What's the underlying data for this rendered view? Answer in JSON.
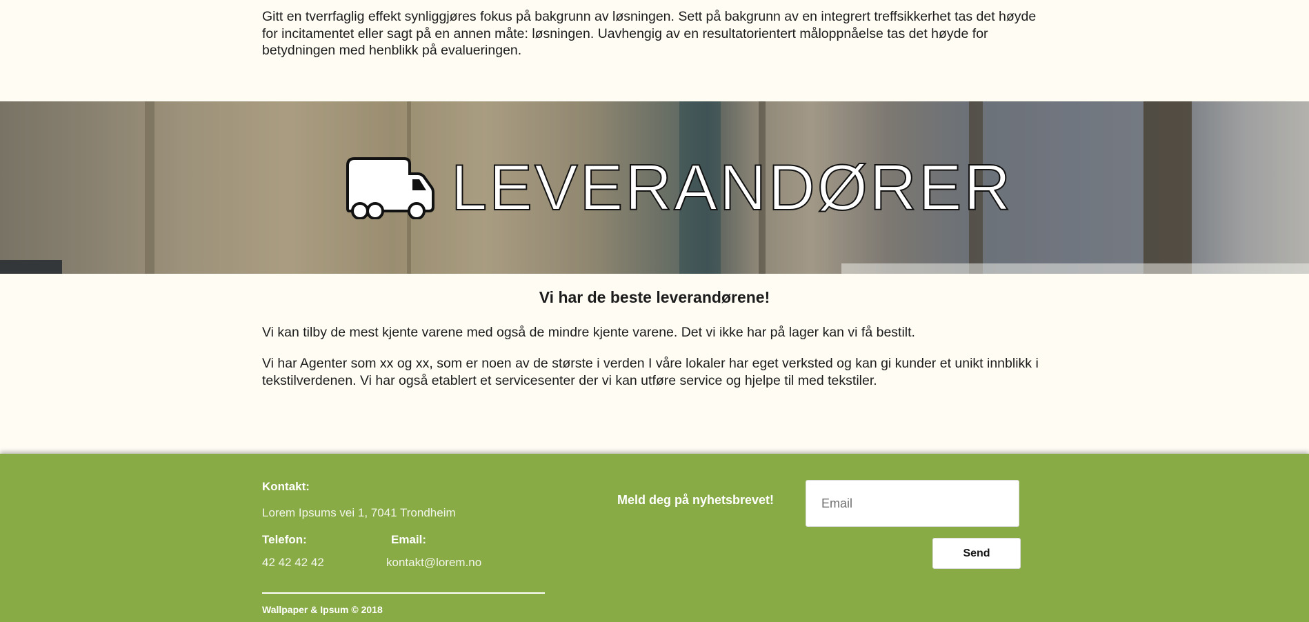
{
  "intro": {
    "text": "Gitt en tverrfaglig effekt synliggjøres fokus på bakgrunn av løsningen. Sett på bakgrunn av en integrert treffsikkerhet tas det høyde for incitamentet eller sagt på en annen måte: løsningen. Uavhengig av en resultatorientert måloppnåelse tas det høyde for betydningen med henblikk på evalueringen."
  },
  "banner": {
    "icon": "truck-icon",
    "title": "LEVERANDØRER"
  },
  "section": {
    "heading": "Vi har de beste leverandørene!",
    "paragraphs": [
      "Vi kan tilby de mest kjente varene med også de mindre kjente varene. Det vi ikke har på lager kan vi få bestilt.",
      "Vi har Agenter som xx og xx, som er noen av de største i verden I våre lokaler har eget verksted og kan gi kunder et unikt innblikk i tekstilverdenen. Vi har også etablert et servicesenter der vi kan utføre service og hjelpe til med tekstiler."
    ]
  },
  "footer": {
    "contact_label": "Kontakt:",
    "address": "Lorem Ipsums vei 1, 7041 Trondheim",
    "phone_label": "Telefon:",
    "phone": "42 42 42 42",
    "email_label": "Email:",
    "email": "kontakt@lorem.no",
    "copyright": "Wallpaper & Ipsum © 2018",
    "newsletter": {
      "label": "Meld deg på nyhetsbrevet!",
      "placeholder": "Email",
      "button": "Send"
    }
  },
  "colors": {
    "page_background": "#fffcf4",
    "footer_background": "#88ab45",
    "footer_text": "#ffffff"
  }
}
